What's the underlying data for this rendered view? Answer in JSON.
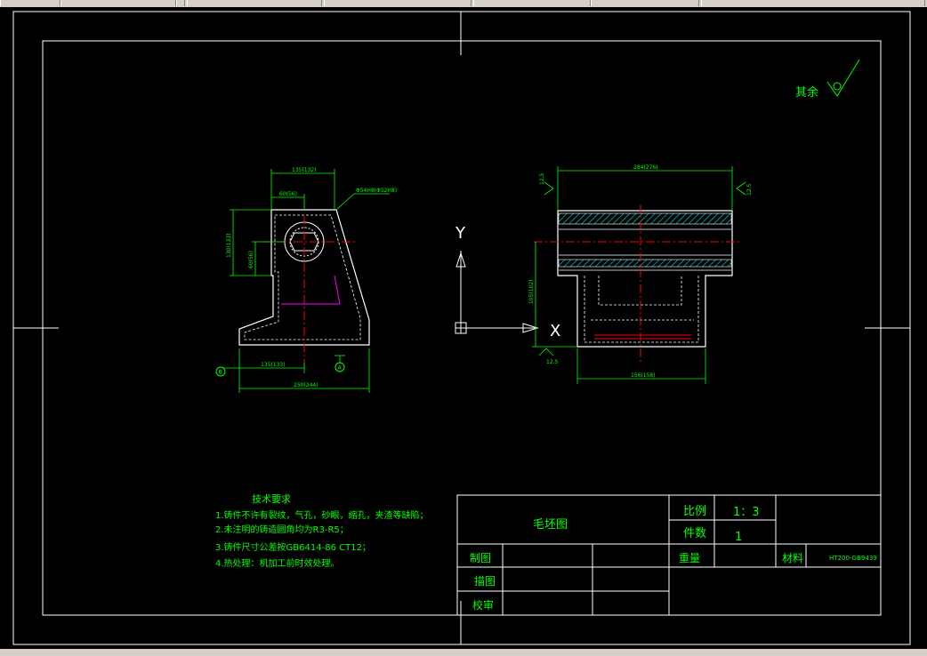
{
  "roughness": {
    "label": "其余"
  },
  "tech_requirements": {
    "title": "技术要求",
    "items": [
      "1.铸件不许有裂纹，气孔，砂眼，缩孔，夹渣等缺陷；",
      "2.未注明的铸造圆角均为R3-R5；",
      "3.铸件尺寸公差按GB6414-86  CT12；",
      "4.热处理：机加工前时效处理。"
    ]
  },
  "title_block": {
    "drawing_name": "毛坯图",
    "scale_label": "比例",
    "scale_value": "1：3",
    "quantity_label": "件数",
    "quantity_value": "1",
    "drawn_label": "制图",
    "weight_label": "重量",
    "material_label": "材料",
    "material_value": "HT200-GB9439",
    "check_label": "描图",
    "review_label": "校审"
  },
  "ucs": {
    "y_label": "Y",
    "x_label": "X"
  },
  "left_view": {
    "dim_top_overall": "135(132)",
    "dim_top_inner": "60(56)",
    "dim_bore": "Φ54H8(Φ52H8)",
    "dim_height_outer": "130(133)",
    "dim_height_inner": "60(56)",
    "dim_bottom_inner": "135(133)",
    "dim_bottom_overall": "250(244)",
    "datum_b": "B",
    "datum_a": "A"
  },
  "right_view": {
    "dim_top": "284(276)",
    "dim_height": "105(102)",
    "dim_bottom": "156(158)",
    "roughness_left": "12.5",
    "roughness_right": "12.5",
    "roughness_bottom": "12.5"
  },
  "colors": {
    "outline": "#ffffff",
    "dimension": "#00ff00",
    "centerline": "#ff0000",
    "hatch": "#00c0c0",
    "accent": "#ff00ff"
  }
}
